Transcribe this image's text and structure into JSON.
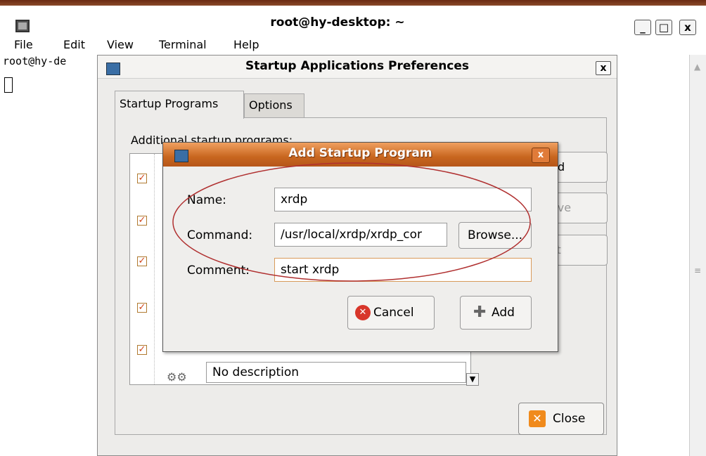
{
  "terminal": {
    "title": "root@hy-desktop: ~",
    "menus": [
      "File",
      "Edit",
      "View",
      "Terminal",
      "Help"
    ],
    "prompt": "root@hy-de",
    "window_controls": [
      "_",
      "□",
      "x"
    ]
  },
  "prefs": {
    "title": "Startup Applications Preferences",
    "close_glyph": "x",
    "tabs": [
      "Startup Programs",
      "Options"
    ],
    "additional_label": "Additional startup programs:",
    "last_item_description": "No description",
    "side_buttons": [
      "d",
      "ove",
      "it"
    ],
    "close_button": "Close"
  },
  "add_dialog": {
    "title": "Add Startup Program",
    "close_glyph": "x",
    "name_label": "Name:",
    "name_value": "xrdp",
    "command_label": "Command:",
    "command_value": "/usr/local/xrdp/xrdp_cor",
    "comment_label": "Comment:",
    "comment_value": "start xrdp",
    "browse_label": "Browse...",
    "cancel_label": "Cancel",
    "add_label": "Add"
  },
  "colors": {
    "dialog_titlebar": "#c8661f",
    "annotation_ellipse": "#b03030"
  }
}
